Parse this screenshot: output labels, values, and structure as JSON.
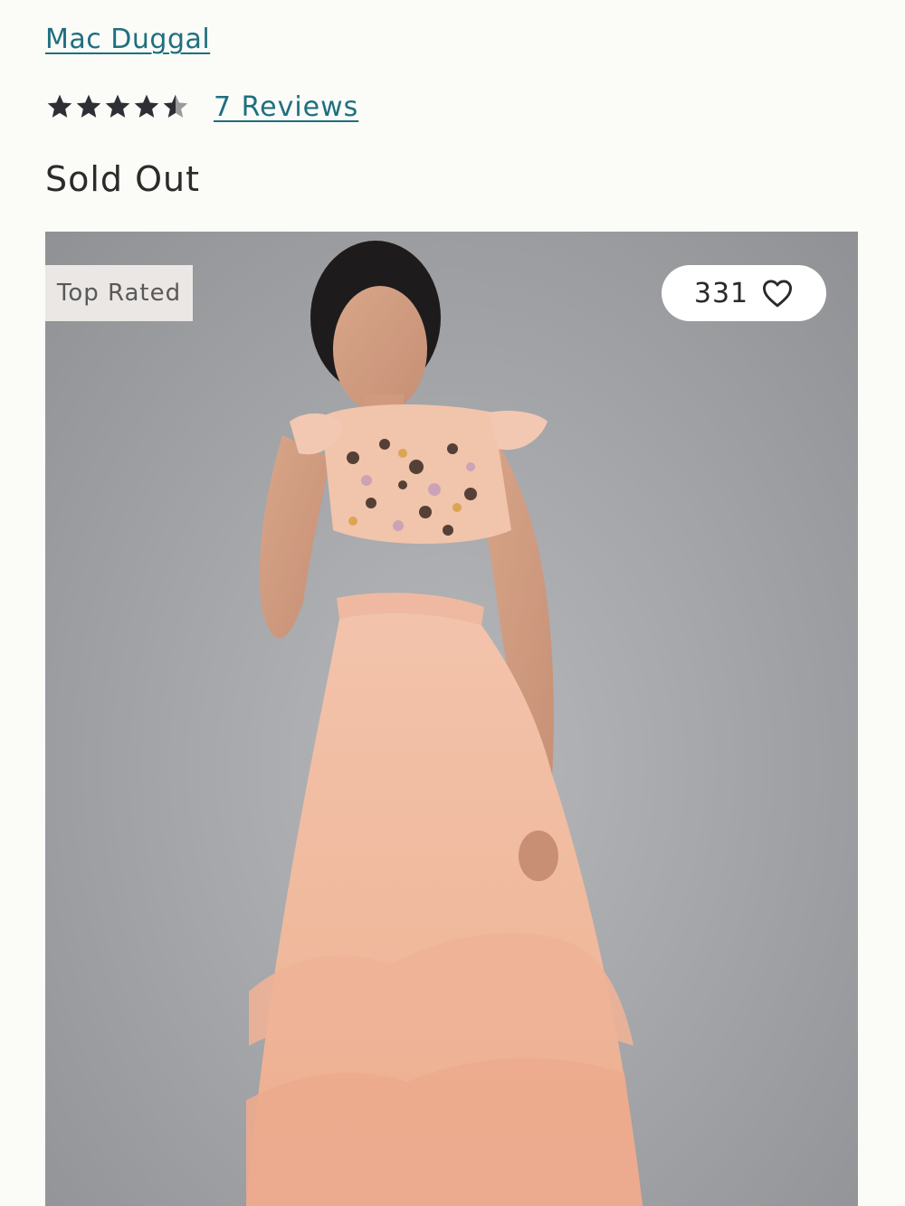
{
  "product": {
    "brand": "Mac Duggal",
    "rating": 4.5,
    "reviews_label": "7 Reviews",
    "availability": "Sold Out",
    "badge": "Top Rated",
    "favorites_count": "331"
  },
  "icons": {
    "favorite": "heart-outline-icon",
    "rating": "star-icon"
  },
  "colors": {
    "link": "#1f6f7f",
    "star": "#2e2e35",
    "badge_bg": "#ebe7e4",
    "background": "#fbfcf8"
  }
}
